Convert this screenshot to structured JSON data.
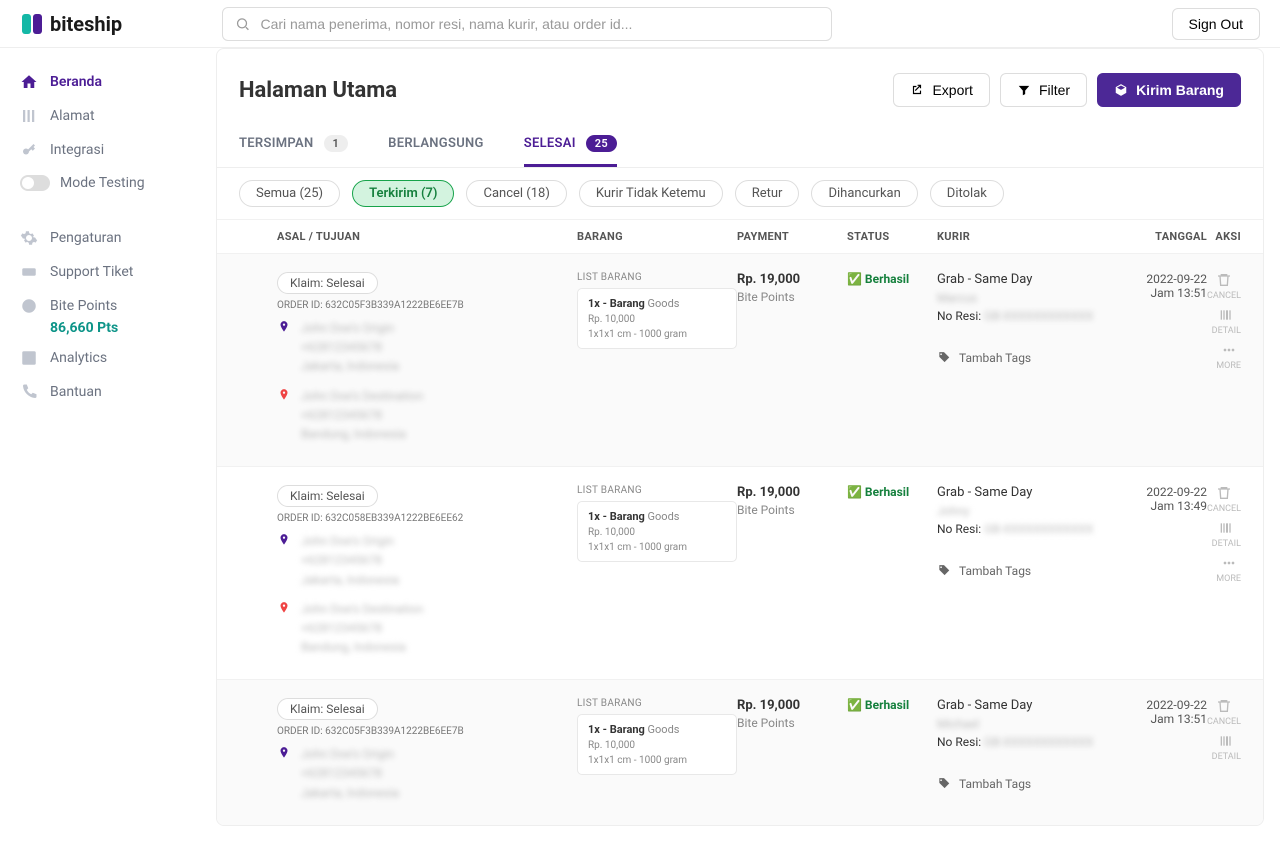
{
  "app": {
    "name": "biteship"
  },
  "search": {
    "placeholder": "Cari nama penerima, nomor resi, nama kurir, atau order id..."
  },
  "header": {
    "signout": "Sign Out"
  },
  "sidebar": {
    "items": [
      "Beranda",
      "Alamat",
      "Integrasi",
      "Mode Testing",
      "Pengaturan",
      "Support Tiket",
      "Bite Points",
      "Analytics",
      "Bantuan"
    ],
    "points": "86,660 Pts"
  },
  "page": {
    "title": "Halaman Utama"
  },
  "buttons": {
    "export": "Export",
    "filter": "Filter",
    "ship": "Kirim Barang"
  },
  "tabs": [
    {
      "label": "TERSIMPAN",
      "badge": "1"
    },
    {
      "label": "BERLANGSUNG",
      "badge": ""
    },
    {
      "label": "SELESAI",
      "badge": "25"
    }
  ],
  "filters": [
    "Semua (25)",
    "Terkirim (7)",
    "Cancel (18)",
    "Kurir Tidak Ketemu",
    "Retur",
    "Dihancurkan",
    "Ditolak"
  ],
  "columns": {
    "asal": "ASAL / TUJUAN",
    "barang": "BARANG",
    "payment": "PAYMENT",
    "status": "STATUS",
    "kurir": "KURIR",
    "tanggal": "TANGGAL",
    "aksi": "AKSI"
  },
  "common": {
    "claim": "Klaim: Selesai",
    "orderIdPrefix": "ORDER ID: ",
    "listBarang": "LIST BARANG",
    "item_qty": "1x - Barang",
    "item_goods": " Goods",
    "item_price": "Rp. 10,000",
    "item_dim": "1x1x1 cm - 1000 gram",
    "paymentAmount": "Rp. 19,000",
    "paymentMethod": "Bite Points",
    "statusText": "✅ Berhasil",
    "courier": "Grab - Same Day",
    "resiPrefix": "No Resi: ",
    "tambahTags": "Tambah Tags",
    "originName": "John Doe's Origin",
    "originPhone": "+62812345678",
    "originCity": "Jakarta, Indonesia",
    "destName": "John Doe's Destination",
    "destPhone": "+62812345678",
    "destCity": "Bandung, Indonesia",
    "blurCode": "GB-XXXXXXXXXXXX"
  },
  "actions": {
    "cancel": "CANCEL",
    "detail": "DETAIL",
    "more": "MORE"
  },
  "orders": [
    {
      "id": "632C05F3B339A1222BE6EE7B",
      "date": "2022-09-22",
      "time": "Jam 13:51",
      "driver": "Marcus"
    },
    {
      "id": "632C058EB339A1222BE6EE62",
      "date": "2022-09-22",
      "time": "Jam 13:49",
      "driver": "Johny"
    },
    {
      "id": "632C05F3B339A1222BE6EE7B",
      "date": "2022-09-22",
      "time": "Jam 13:51",
      "driver": "Michael"
    }
  ]
}
